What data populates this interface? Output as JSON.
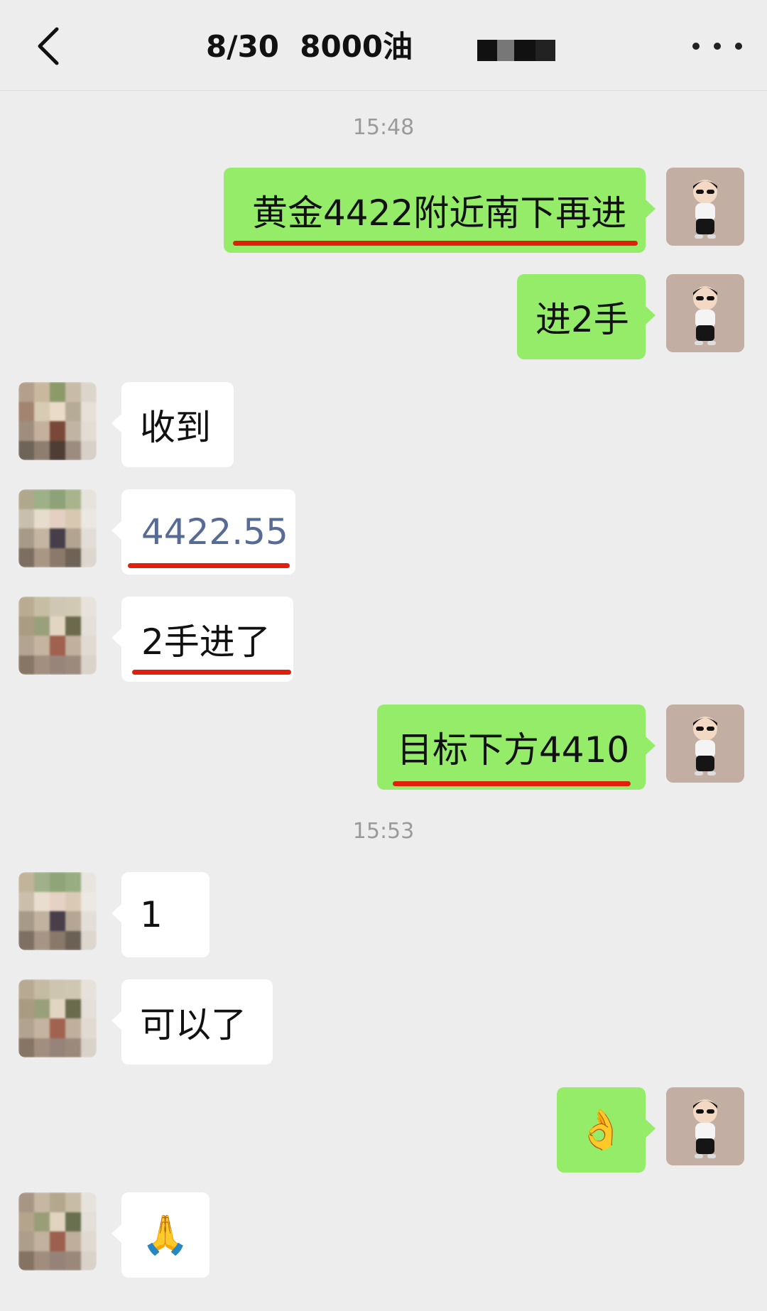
{
  "header": {
    "title": "8/30  8000油",
    "back_icon": "chevron-left-icon",
    "more_icon": "more-dots-icon"
  },
  "timestamps": [
    "15:48",
    "15:53"
  ],
  "messages": [
    {
      "from": "me",
      "text": "黄金4422附近南下再进",
      "underlined": true
    },
    {
      "from": "me",
      "text": "进2手",
      "underlined": false
    },
    {
      "from": "other",
      "text": "收到",
      "underlined": false
    },
    {
      "from": "other",
      "text": "4422.55",
      "underlined": true,
      "link": true
    },
    {
      "from": "other",
      "text": "2手进了",
      "underlined": true
    },
    {
      "from": "me",
      "text": "目标下方4410",
      "underlined": true
    },
    {
      "from": "other",
      "text": "1",
      "underlined": false
    },
    {
      "from": "other",
      "text": "可以了",
      "underlined": false
    },
    {
      "from": "me",
      "text": "👌",
      "underlined": false
    },
    {
      "from": "other",
      "text": "🙏",
      "underlined": false
    }
  ],
  "colors": {
    "background": "#ededed",
    "bubble_me": "#95ec69",
    "bubble_other": "#ffffff",
    "link_text": "#576b95",
    "underline_annotation": "#e0200c",
    "timestamp": "#9a9a9a"
  }
}
